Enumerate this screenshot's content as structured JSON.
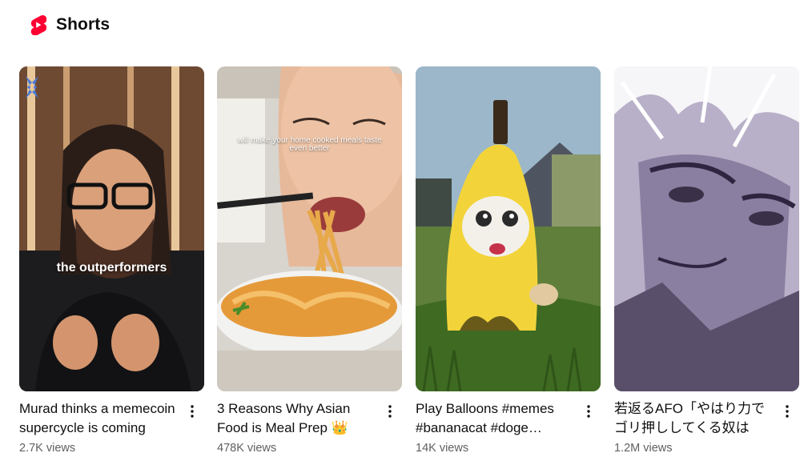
{
  "section": {
    "title": "Shorts",
    "accent_color": "#ff0033"
  },
  "shorts": [
    {
      "title": "Murad thinks a memecoin supercycle is coming",
      "views": "2.7K views",
      "overlay_text": "the outperformers"
    },
    {
      "title": "3 Reasons Why Asian Food is Meal Prep 👑",
      "views": "478K views",
      "overlay_text": "will make your home cooked meals taste even better"
    },
    {
      "title": "Play Balloons #memes #bananacat #doge #shorts",
      "views": "14K views",
      "overlay_text": ""
    },
    {
      "title": "若返るAFO「やはり力でゴリ押ししてくる奴は",
      "views": "1.2M views",
      "overlay_text": ""
    }
  ],
  "icons": {
    "logo": "youtube-shorts-icon",
    "more": "more-vertical-icon"
  }
}
